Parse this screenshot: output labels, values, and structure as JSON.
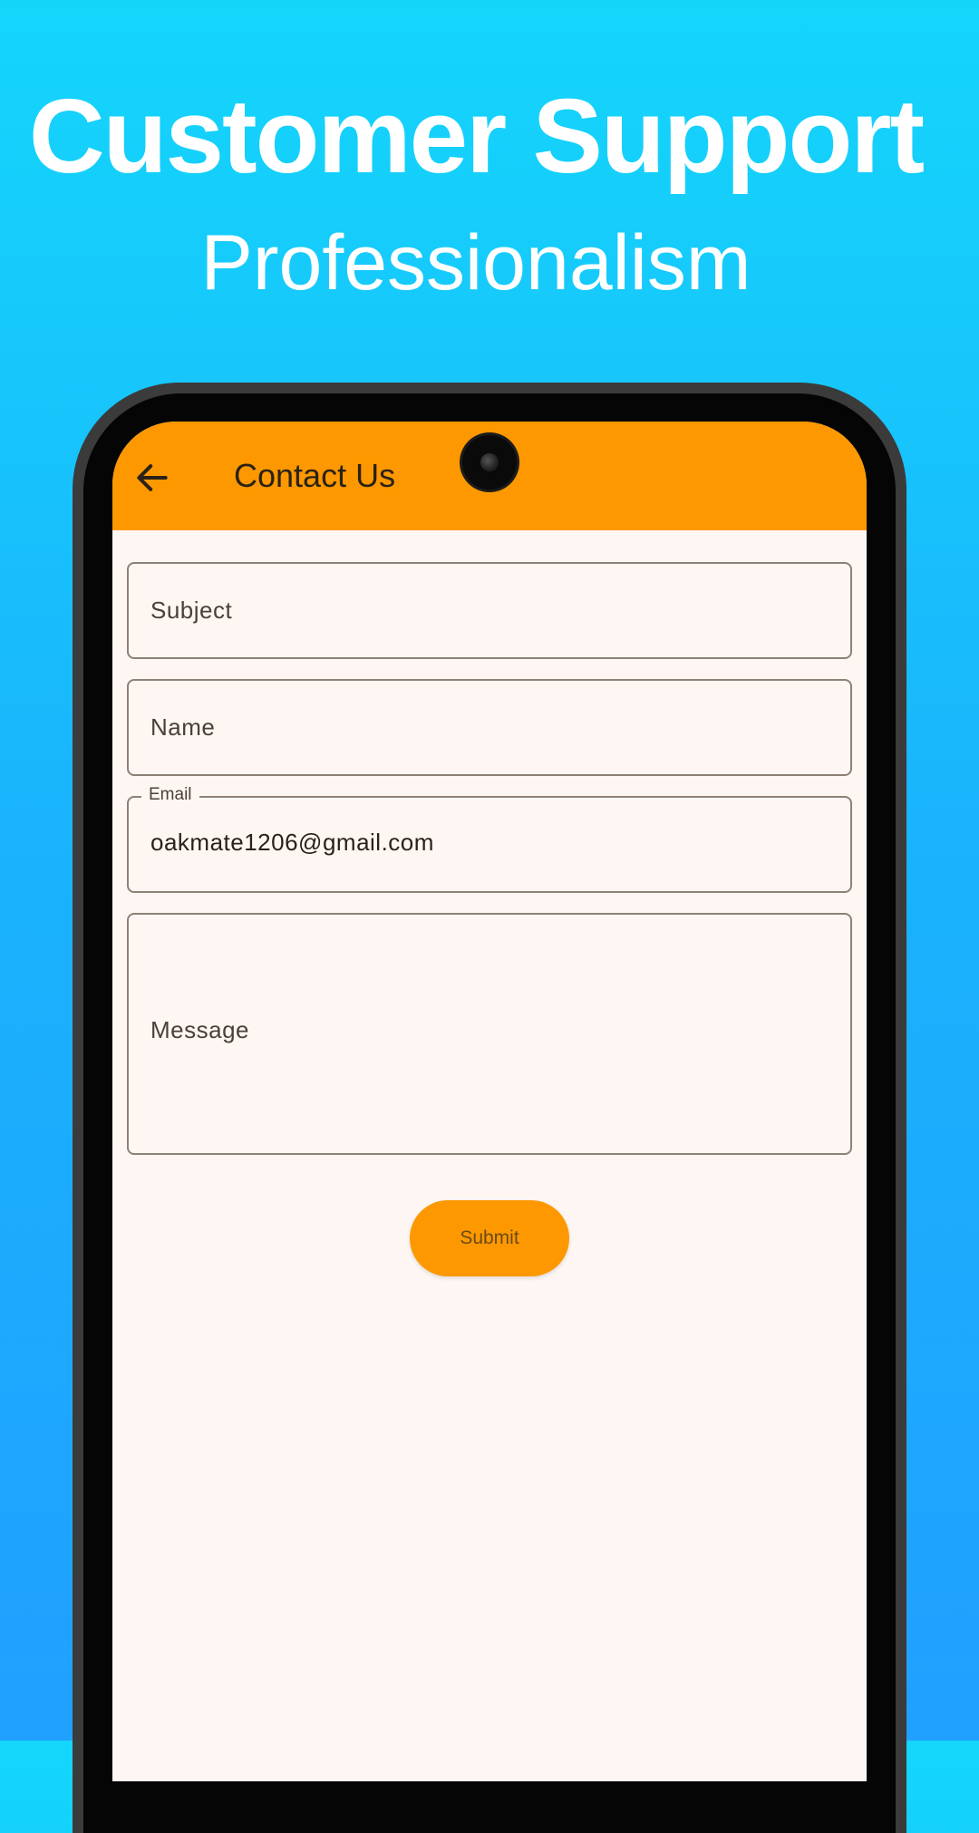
{
  "headline": {
    "title": "Customer Support",
    "subtitle": "Professionalism"
  },
  "app_bar": {
    "title": "Contact Us",
    "back_icon": "arrow-left-icon"
  },
  "form": {
    "subject": {
      "placeholder": "Subject",
      "value": ""
    },
    "name": {
      "placeholder": "Name",
      "value": ""
    },
    "email": {
      "label": "Email",
      "value": "oakmate1206@gmail.com"
    },
    "message": {
      "placeholder": "Message",
      "value": ""
    },
    "submit_label": "Submit"
  },
  "colors": {
    "background_top": "#14d6fb",
    "background_bottom": "#20a0ff",
    "accent": "#fd9800",
    "screen_background": "#fdf6f3"
  }
}
